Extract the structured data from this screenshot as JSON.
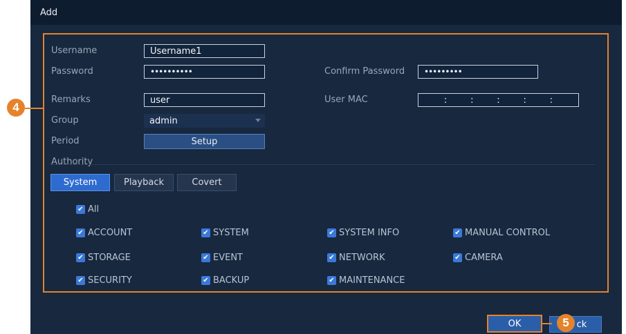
{
  "dialog": {
    "title": "Add"
  },
  "form": {
    "username_label": "Username",
    "username_value": "Username1",
    "password_label": "Password",
    "password_value": "••••••••••",
    "confirm_label": "Confirm Password",
    "confirm_value": "•••••••••",
    "remarks_label": "Remarks",
    "remarks_value": "user",
    "usermac_label": "User MAC",
    "usermac_seps": [
      ":",
      ":",
      ":",
      ":",
      ":"
    ],
    "group_label": "Group",
    "group_value": "admin",
    "period_label": "Period",
    "setup_label": "Setup",
    "authority_label": "Authority"
  },
  "tabs": [
    {
      "label": "System",
      "active": true
    },
    {
      "label": "Playback",
      "active": false
    },
    {
      "label": "Covert",
      "active": false
    }
  ],
  "permissions": {
    "all_label": "All",
    "items": [
      "ACCOUNT",
      "SYSTEM",
      "SYSTEM INFO",
      "MANUAL CONTROL",
      "STORAGE",
      "EVENT",
      "NETWORK",
      "CAMERA",
      "SECURITY",
      "BACKUP",
      "MAINTENANCE"
    ],
    "checked": true
  },
  "footer": {
    "ok_label": "OK",
    "back_label_visible": "ck"
  },
  "callouts": {
    "badge_4": "4",
    "badge_5": "5",
    "accent_color": "#e5832b"
  },
  "colors": {
    "background": "#17283f",
    "active_tab": "#2e6bd0",
    "checkbox": "#3b79d8"
  }
}
